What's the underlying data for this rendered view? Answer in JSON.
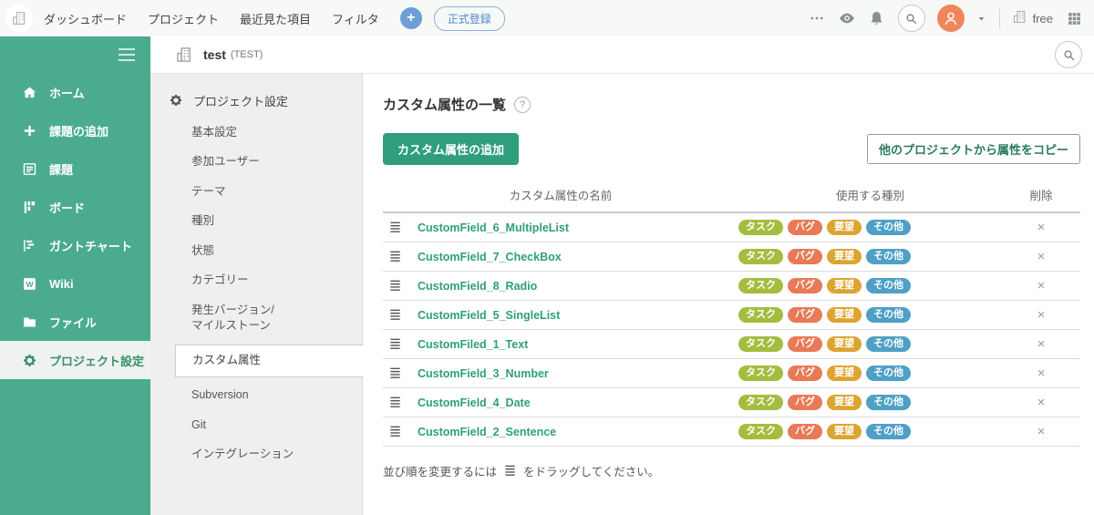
{
  "topnav": {
    "nav_items": [
      {
        "id": "dashboard",
        "label": "ダッシュボード"
      },
      {
        "id": "projects",
        "label": "プロジェクト"
      },
      {
        "id": "recent",
        "label": "最近見た項目"
      },
      {
        "id": "filter",
        "label": "フィルタ"
      }
    ],
    "add_button_label": "+",
    "register_button_label": "正式登録",
    "plan_label": "free",
    "right_icons": [
      "more-icon",
      "watch-eye-icon",
      "notifications-bell-icon",
      "search-icon",
      "avatar",
      "chevron-down-icon",
      "organization-icon",
      "apps-grid-icon"
    ]
  },
  "sidebar": {
    "items": [
      {
        "id": "home",
        "icon": "home-icon",
        "label": "ホーム",
        "active": false
      },
      {
        "id": "add-issue",
        "icon": "plus-icon",
        "label": "課題の追加",
        "active": false
      },
      {
        "id": "issues",
        "icon": "issue-list-icon",
        "label": "課題",
        "active": false
      },
      {
        "id": "board",
        "icon": "board-icon",
        "label": "ボード",
        "active": false
      },
      {
        "id": "gantt",
        "icon": "gantt-chart-icon",
        "label": "ガントチャート",
        "active": false
      },
      {
        "id": "wiki",
        "icon": "wiki-icon",
        "label": "Wiki",
        "active": false
      },
      {
        "id": "files",
        "icon": "files-icon",
        "label": "ファイル",
        "active": false
      },
      {
        "id": "project-settings",
        "icon": "gear-icon",
        "label": "プロジェクト設定",
        "active": true
      }
    ]
  },
  "project_header": {
    "name": "test",
    "key": "(TEST)"
  },
  "settings_menu": {
    "header_label": "プロジェクト設定",
    "items": [
      {
        "id": "basic",
        "label": "基本設定",
        "active": false
      },
      {
        "id": "members",
        "label": "参加ユーザー",
        "active": false
      },
      {
        "id": "theme",
        "label": "テーマ",
        "active": false
      },
      {
        "id": "issue-types",
        "label": "種別",
        "active": false
      },
      {
        "id": "statuses",
        "label": "状態",
        "active": false
      },
      {
        "id": "categories",
        "label": "カテゴリー",
        "active": false
      },
      {
        "id": "versions-milestones",
        "label": "発生バージョン/\nマイルストーン",
        "active": false
      },
      {
        "id": "custom-fields",
        "label": "カスタム属性",
        "active": true
      },
      {
        "id": "subversion",
        "label": "Subversion",
        "active": false
      },
      {
        "id": "git",
        "label": "Git",
        "active": false
      },
      {
        "id": "integrations",
        "label": "インテグレーション",
        "active": false
      }
    ]
  },
  "main": {
    "title": "カスタム属性の一覧",
    "help_label": "?",
    "add_button_label": "カスタム属性の追加",
    "copy_button_label": "他のプロジェクトから属性をコピー",
    "table": {
      "headers": {
        "name": "カスタム属性の名前",
        "types": "使用する種別",
        "delete": "削除"
      },
      "delete_glyph": "×",
      "rows": [
        {
          "name": "CustomField_6_MultipleList",
          "types": [
            "タスク",
            "バグ",
            "要望",
            "その他"
          ]
        },
        {
          "name": "CustomField_7_CheckBox",
          "types": [
            "タスク",
            "バグ",
            "要望",
            "その他"
          ]
        },
        {
          "name": "CustomField_8_Radio",
          "types": [
            "タスク",
            "バグ",
            "要望",
            "その他"
          ]
        },
        {
          "name": "CustomField_5_SingleList",
          "types": [
            "タスク",
            "バグ",
            "要望",
            "その他"
          ]
        },
        {
          "name": "CustomFiled_1_Text",
          "types": [
            "タスク",
            "バグ",
            "要望",
            "その他"
          ]
        },
        {
          "name": "CustomField_3_Number",
          "types": [
            "タスク",
            "バグ",
            "要望",
            "その他"
          ]
        },
        {
          "name": "CustomField_4_Date",
          "types": [
            "タスク",
            "バグ",
            "要望",
            "その他"
          ]
        },
        {
          "name": "CustomField_2_Sentence",
          "types": [
            "タスク",
            "バグ",
            "要望",
            "その他"
          ]
        }
      ]
    },
    "footer_note": {
      "before": "並び順を変更するには",
      "after": "をドラッグしてください。"
    }
  },
  "badge_colors": {
    "タスク": "#a4bd3f",
    "バグ": "#e87a57",
    "要望": "#dda431",
    "その他": "#4fa0c6"
  },
  "colors": {
    "sidebar_green": "#4bab8f",
    "accent_green": "#2f9e7c",
    "link_green": "#2f9e7d",
    "topnav_blue": "#6d9ed7",
    "avatar_orange": "#ef875d"
  }
}
